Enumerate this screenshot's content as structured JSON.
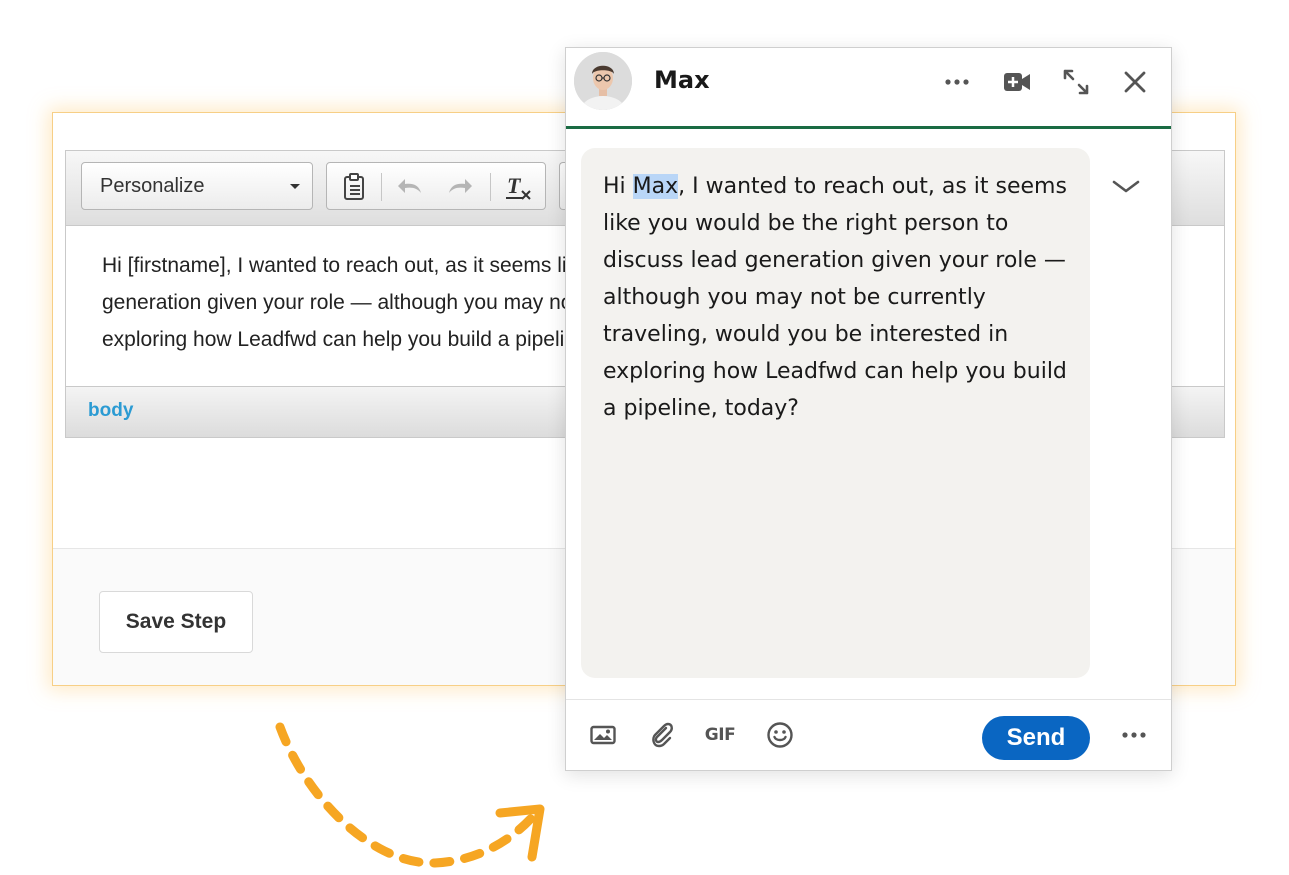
{
  "editor": {
    "personalize_label": "Personalize",
    "body_lines": [
      "Hi [firstname], I wanted to reach out, as it seems like you would be the right person to discuss lead",
      "generation given your role — although you may not be currently traveling, would you be interested in",
      "exploring how Leadfwd can help you build a pipeline, today?"
    ],
    "status_label": "body",
    "save_step_label": "Save Step",
    "toolbar_icons": [
      "paste-icon",
      "undo-icon",
      "redo-icon",
      "clear-format-icon"
    ]
  },
  "chat": {
    "contact_name": "Max",
    "message_before": "Hi ",
    "message_highlight": "Max",
    "message_after": ", I wanted to reach out, as it seems like you would be the right person to discuss lead generation given your role — although you may not be currently traveling, would you be interested in exploring how Leadfwd can help you build a pipeline, today?",
    "send_label": "Send",
    "gif_label": "GIF",
    "header_icons": [
      "more-icon",
      "video-call-icon",
      "expand-icon",
      "close-icon"
    ],
    "footer_icons": [
      "image-icon",
      "attach-icon",
      "gif-icon",
      "emoji-icon",
      "more-icon"
    ]
  },
  "colors": {
    "accent_orange": "#f6a623",
    "send_blue": "#0a66c2",
    "header_rule_green": "#1a6b43",
    "link_blue": "#2b9bd3"
  }
}
